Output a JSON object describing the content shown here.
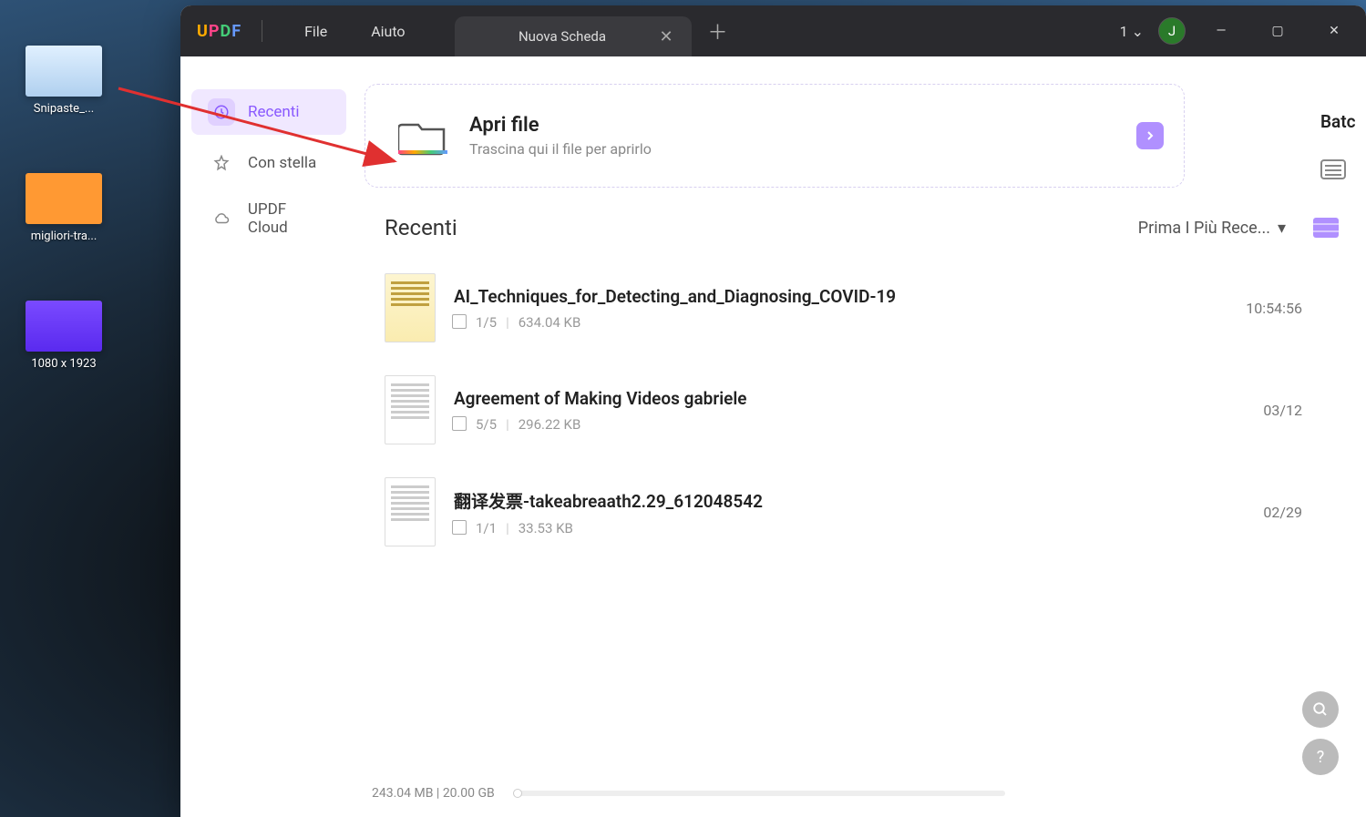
{
  "desktop": {
    "icons": [
      {
        "label": "Snipaste_..."
      },
      {
        "label": "migliori-tra..."
      },
      {
        "label": "1080 x 1923"
      }
    ]
  },
  "app": {
    "logo": {
      "u": "U",
      "p": "P",
      "d": "D",
      "f": "F"
    },
    "menu": {
      "file": "File",
      "help": "Aiuto"
    },
    "tab": {
      "title": "Nuova Scheda"
    },
    "account": {
      "count": "1",
      "initial": "J"
    }
  },
  "sidebar": {
    "recent": "Recenti",
    "starred": "Con stella",
    "cloud": "UPDF Cloud"
  },
  "open": {
    "title": "Apri file",
    "subtitle": "Trascina qui il file per aprirlo"
  },
  "batch": {
    "title": "Batc"
  },
  "recent": {
    "title": "Recenti",
    "sort": "Prima I Più Rece..."
  },
  "files": [
    {
      "name": "AI_Techniques_for_Detecting_and_Diagnosing_COVID-19",
      "pages": "1/5",
      "size": "634.04 KB",
      "date": "10:54:56",
      "thumb": "yellow"
    },
    {
      "name": "Agreement of Making Videos gabriele",
      "pages": "5/5",
      "size": "296.22 KB",
      "date": "03/12",
      "thumb": "white"
    },
    {
      "name": "翻译发票-takeabreaath2.29_612048542",
      "pages": "1/1",
      "size": "33.53 KB",
      "date": "02/29",
      "thumb": "white"
    }
  ],
  "storage": {
    "text": "243.04 MB | 20.00 GB"
  }
}
